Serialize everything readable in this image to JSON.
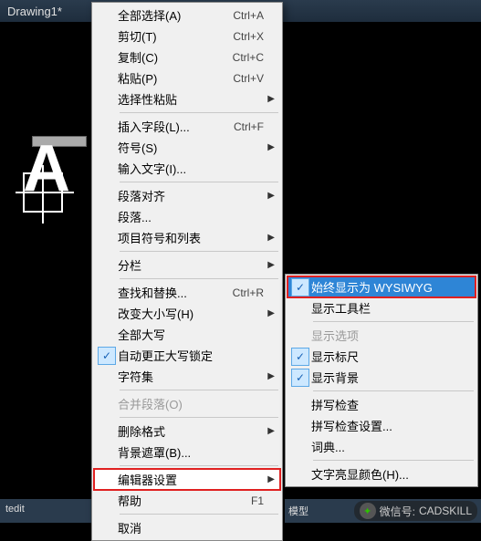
{
  "titlebar": {
    "title": "Drawing1*"
  },
  "canvas": {
    "letter": "A",
    "statusText": "tedit"
  },
  "mainMenu": {
    "items": [
      {
        "label": "全部选择(A)",
        "shortcut": "Ctrl+A",
        "type": "item"
      },
      {
        "label": "剪切(T)",
        "shortcut": "Ctrl+X",
        "type": "item"
      },
      {
        "label": "复制(C)",
        "shortcut": "Ctrl+C",
        "type": "item"
      },
      {
        "label": "粘贴(P)",
        "shortcut": "Ctrl+V",
        "type": "item"
      },
      {
        "label": "选择性粘贴",
        "type": "sub"
      },
      {
        "type": "sep"
      },
      {
        "label": "插入字段(L)...",
        "shortcut": "Ctrl+F",
        "type": "item"
      },
      {
        "label": "符号(S)",
        "type": "sub"
      },
      {
        "label": "输入文字(I)...",
        "type": "item"
      },
      {
        "type": "sep"
      },
      {
        "label": "段落对齐",
        "type": "sub"
      },
      {
        "label": "段落...",
        "type": "item"
      },
      {
        "label": "项目符号和列表",
        "type": "sub"
      },
      {
        "type": "sep"
      },
      {
        "label": "分栏",
        "type": "sub"
      },
      {
        "type": "sep"
      },
      {
        "label": "查找和替换...",
        "shortcut": "Ctrl+R",
        "type": "item"
      },
      {
        "label": "改变大小写(H)",
        "type": "sub"
      },
      {
        "label": "全部大写",
        "type": "item"
      },
      {
        "label": "自动更正大写锁定",
        "type": "item",
        "checked": true
      },
      {
        "label": "字符集",
        "type": "sub"
      },
      {
        "type": "sep"
      },
      {
        "label": "合并段落(O)",
        "type": "item",
        "disabled": true
      },
      {
        "type": "sep"
      },
      {
        "label": "删除格式",
        "type": "sub"
      },
      {
        "label": "背景遮罩(B)...",
        "type": "item"
      },
      {
        "type": "sep"
      },
      {
        "label": "编辑器设置",
        "type": "sub",
        "highlighted": true
      },
      {
        "label": "帮助",
        "shortcut": "F1",
        "type": "item"
      },
      {
        "type": "sep"
      },
      {
        "label": "取消",
        "type": "item"
      }
    ]
  },
  "subMenu": {
    "items": [
      {
        "label": "始终显示为 WYSIWYG",
        "checked": true,
        "selected": true
      },
      {
        "label": "显示工具栏",
        "type": "item"
      },
      {
        "type": "sep"
      },
      {
        "label": "显示选项",
        "disabled": true
      },
      {
        "label": "显示标尺",
        "checked": true
      },
      {
        "label": "显示背景",
        "checked": true
      },
      {
        "type": "sep"
      },
      {
        "label": "拼写检查",
        "type": "item"
      },
      {
        "label": "拼写检查设置...",
        "type": "item"
      },
      {
        "label": "词典...",
        "type": "item"
      },
      {
        "type": "sep"
      },
      {
        "label": "文字亮显颜色(H)...",
        "type": "item"
      }
    ]
  },
  "rightStatus": {
    "items": [
      "模型"
    ]
  },
  "wechat": {
    "prefix": "微信号:",
    "handle": "CADSKILL"
  }
}
